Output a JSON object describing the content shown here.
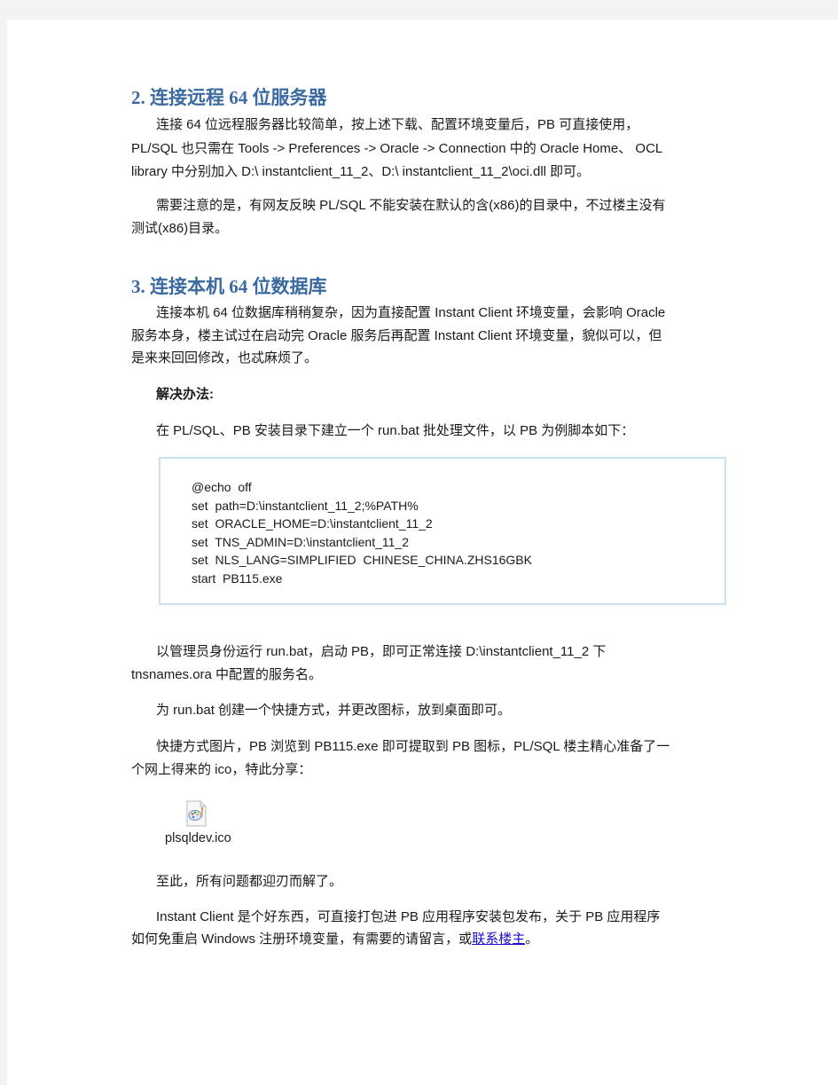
{
  "sections": [
    {
      "heading": "2. 连接远程 64 位服务器",
      "paragraphs": [
        "连接 64 位远程服务器比较简单，按上述下载、配置环境变量后，PB 可直接使用，",
        "PL/SQL 也只需在 Tools  -> Preferences -> Oracle  -> Connection 中的 Oracle Home、 OCL",
        "library 中分别加入 D:\\ instantclient_11_2、D:\\ instantclient_11_2\\oci.dll 即可。"
      ],
      "note_line1": "需要注意的是，有网友反映 PL/SQL 不能安装在默认的含(x86)的目录中，不过楼主没有",
      "note_line2": "测试(x86)目录。"
    },
    {
      "heading": "3. 连接本机 64 位数据库",
      "paragraph_line1": "连接本机 64 位数据库稍稍复杂，因为直接配置 Instant Client 环境变量，会影响 Oracle",
      "paragraph_line2": "服务本身，楼主试过在启动完 Oracle 服务后再配置 Instant Client 环境变量，貌似可以，但",
      "paragraph_line3": "是来来回回修改，也忒麻烦了。",
      "solution_label": "解决办法:",
      "instruction": "在 PL/SQL、PB 安装目录下建立一个 run.bat 批处理文件，以 PB 为例脚本如下："
    }
  ],
  "code_lines": [
    "@echo  off",
    "set  path=D:\\instantclient_11_2;%PATH%",
    "set  ORACLE_HOME=D:\\instantclient_11_2",
    "set  TNS_ADMIN=D:\\instantclient_11_2",
    "set  NLS_LANG=SIMPLIFIED  CHINESE_CHINA.ZHS16GBK",
    "start  PB115.exe"
  ],
  "after_code": {
    "run_line1": "以管理员身份运行 run.bat，启动 PB，即可正常连接 D:\\instantclient_11_2 下",
    "run_line2": "tnsnames.ora 中配置的服务名。",
    "shortcut": "为 run.bat 创建一个快捷方式，并更改图标，放到桌面即可。",
    "icon_line1": "快捷方式图片，PB 浏览到 PB115.exe 即可提取到 PB 图标，PL/SQL 楼主精心准备了一",
    "icon_line2": "个网上得来的 ico，特此分享：",
    "attachment_name": "plsqldev.ico",
    "resolved": "至此，所有问题都迎刃而解了。",
    "final_line1": "Instant  Client 是个好东西，可直接打包进 PB 应用程序安装包发布，关于 PB 应用程序",
    "final_line2_prefix": "如何免重启 Windows 注册环境变量，有需要的请留言，或",
    "contact_link": "联系楼主",
    "final_suffix": "。"
  },
  "colors": {
    "heading": "#3a6aa0",
    "link": "#1a0dcc",
    "code_border": "#c9e2ec",
    "background": "#f3f3f3"
  }
}
